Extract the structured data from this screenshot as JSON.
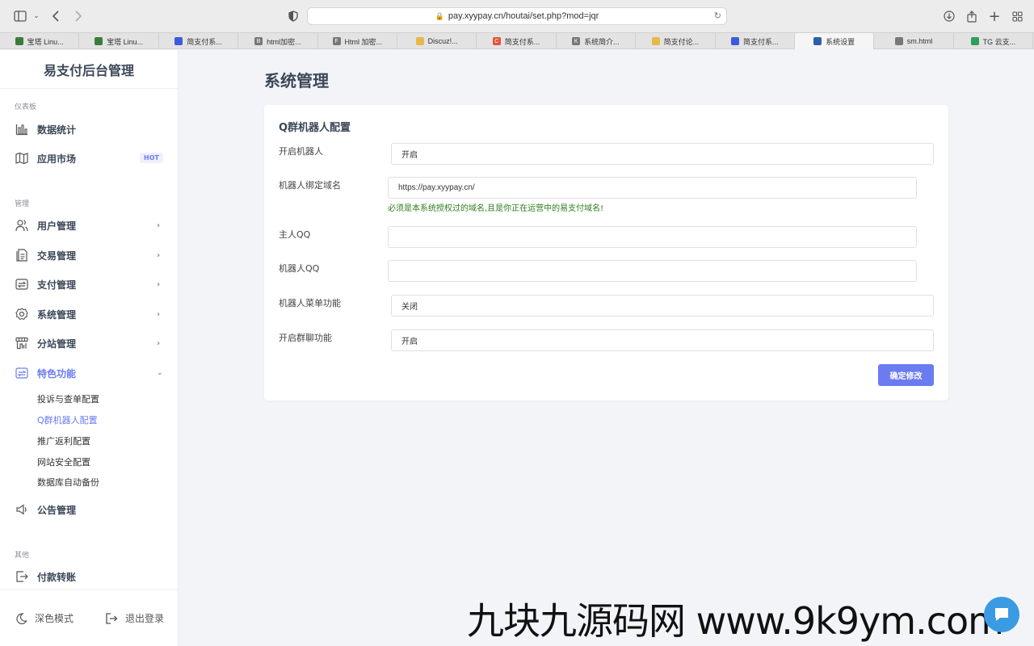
{
  "browser": {
    "url": "pay.xyypay.cn/houtai/set.php?mod=jqr",
    "tabs": [
      {
        "label": "宝塔 Linu...",
        "color": "#3a7d3a",
        "glyph": ""
      },
      {
        "label": "宝塔 Linu...",
        "color": "#3a7d3a",
        "glyph": ""
      },
      {
        "label": "简支付系...",
        "color": "#3b5bdb",
        "glyph": ""
      },
      {
        "label": "html加密...",
        "color": "#777777",
        "glyph": "B"
      },
      {
        "label": "Html 加密...",
        "color": "#777777",
        "glyph": "F"
      },
      {
        "label": "Discuz!...",
        "color": "#e8b84a",
        "glyph": ""
      },
      {
        "label": "简支付系...",
        "color": "#e0553a",
        "glyph": "C"
      },
      {
        "label": "系统简介...",
        "color": "#777777",
        "glyph": "K"
      },
      {
        "label": "简支付论...",
        "color": "#e8b84a",
        "glyph": ""
      },
      {
        "label": "简支付系...",
        "color": "#3b5bdb",
        "glyph": ""
      },
      {
        "label": "系统设置",
        "color": "#2e5fa8",
        "glyph": ""
      },
      {
        "label": "sm.html",
        "color": "#777777",
        "glyph": ""
      },
      {
        "label": "TG 云支...",
        "color": "#2e9e5b",
        "glyph": ""
      }
    ],
    "active_tab": 10
  },
  "sidebar": {
    "brand": "易支付后台管理",
    "sections": {
      "dashboard": "仪表板",
      "manage": "管理",
      "other": "其他"
    },
    "items": {
      "stats": "数据统计",
      "market": "应用市场",
      "market_badge": "HOT",
      "users": "用户管理",
      "trade": "交易管理",
      "pay": "支付管理",
      "system": "系统管理",
      "substation": "分站管理",
      "features": "特色功能",
      "notice": "公告管理",
      "transfer": "付款转账"
    },
    "sub_items": [
      "投诉与查单配置",
      "Q群机器人配置",
      "推广返利配置",
      "网站安全配置",
      "数据库自动备份"
    ],
    "active_sub": 1,
    "footer": {
      "dark_mode": "深色模式",
      "logout": "退出登录"
    }
  },
  "main": {
    "page_title": "系统管理",
    "card_title": "Q群机器人配置",
    "fields": {
      "enable_bot": {
        "label": "开启机器人",
        "value": "开启"
      },
      "bot_domain": {
        "label": "机器人绑定域名",
        "value": "https://pay.xyypay.cn/",
        "hint": "必须是本系统授权过的域名,且是你正在运营中的易支付域名!"
      },
      "owner_qq": {
        "label": "主人QQ",
        "value": ""
      },
      "bot_qq": {
        "label": "机器人QQ",
        "value": ""
      },
      "bot_menu": {
        "label": "机器人菜单功能",
        "value": "关闭"
      },
      "group_chat": {
        "label": "开启群聊功能",
        "value": "开启"
      }
    },
    "submit": "确定修改"
  },
  "watermark": "九块九源码网 www.9k9ym.com",
  "colors": {
    "accent": "#6b7cf0",
    "hint": "#2e7d1e",
    "background": "#f3f4f8"
  }
}
